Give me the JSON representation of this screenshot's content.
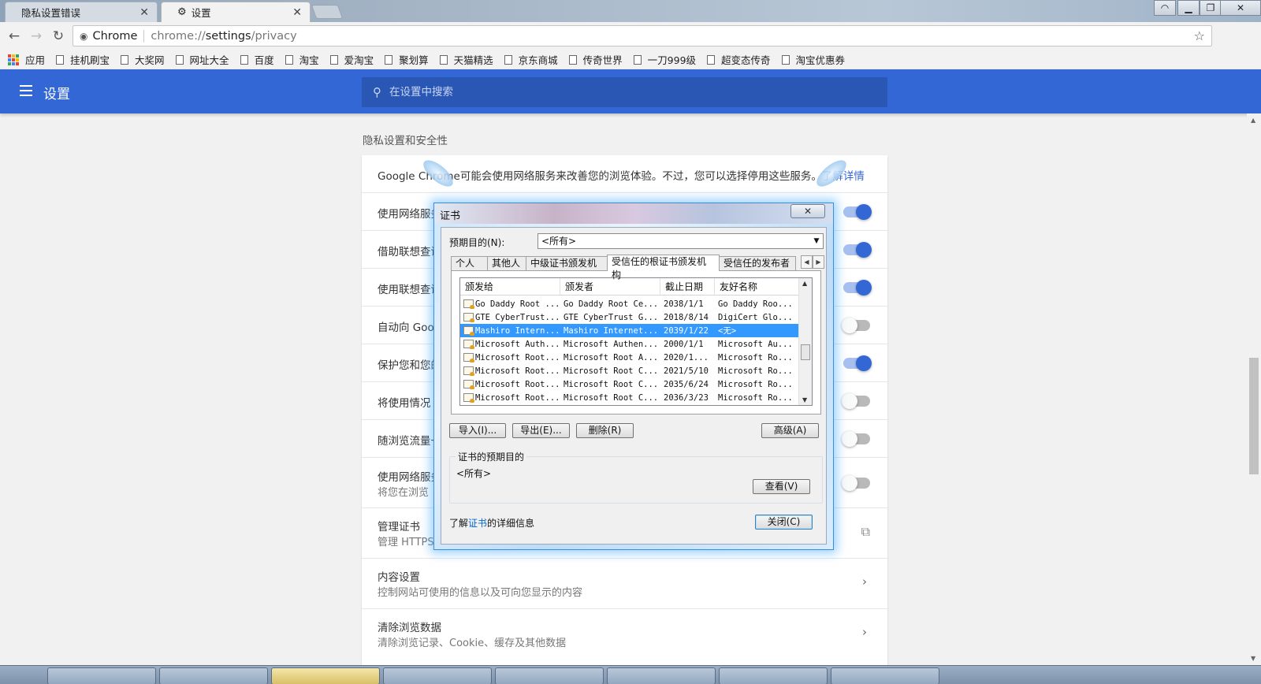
{
  "browser": {
    "tabs": [
      {
        "title": "隐私设置错误",
        "active": false
      },
      {
        "title": "设置",
        "active": true
      }
    ],
    "omnibox": {
      "chip": "Chrome",
      "url_scheme": "chrome://",
      "url_host": "settings",
      "url_path": "/privacy"
    },
    "bookmarks": [
      {
        "label": "应用",
        "icon": "apps-grid-icon"
      },
      {
        "label": "挂机刷宝"
      },
      {
        "label": "大奖网"
      },
      {
        "label": "网址大全"
      },
      {
        "label": "百度"
      },
      {
        "label": "淘宝"
      },
      {
        "label": "爱淘宝"
      },
      {
        "label": "聚划算"
      },
      {
        "label": "天猫精选"
      },
      {
        "label": "京东商城"
      },
      {
        "label": "传奇世界"
      },
      {
        "label": "一刀999级"
      },
      {
        "label": "超变态传奇"
      },
      {
        "label": "淘宝优惠券"
      }
    ]
  },
  "settings": {
    "title": "设置",
    "search_placeholder": "在设置中搜索",
    "section_title": "隐私设置和安全性",
    "intro_text": "Google Chrome可能会使用网络服务来改善您的浏览体验。不过，您可以选择停用这些服务。",
    "intro_link": "了解详情",
    "rows": [
      {
        "label": "使用网络服务",
        "toggle": "on"
      },
      {
        "label": "借助联想查询",
        "toggle": "on"
      },
      {
        "label": "使用联想查询",
        "toggle": "on"
      },
      {
        "label": "自动向 Google",
        "toggle": "off"
      },
      {
        "label": "保护您和您的",
        "toggle": "on"
      },
      {
        "label": "将使用情况",
        "toggle": "off"
      },
      {
        "label": "随浏览流量一",
        "toggle": "off"
      },
      {
        "label": "使用网络服务",
        "sub": "将您在浏览",
        "toggle": "off"
      },
      {
        "label": "管理证书",
        "sub": "管理 HTTPS/SSL 证书和设置",
        "action": "external-link-icon"
      },
      {
        "label": "内容设置",
        "sub": "控制网站可使用的信息以及可向您显示的内容",
        "action": "chevron-right-icon"
      },
      {
        "label": "清除浏览数据",
        "sub": "清除浏览记录、Cookie、缓存及其他数据",
        "action": "chevron-right-icon"
      }
    ]
  },
  "cert_dialog": {
    "title": "证书",
    "close_x": "✕",
    "purpose_label": "预期目的(N):",
    "purpose_value": "<所有>",
    "tabs": [
      "个人",
      "其他人",
      "中级证书颁发机构",
      "受信任的根证书颁发机构",
      "受信任的发布者"
    ],
    "active_tab": 3,
    "columns": [
      "颁发给",
      "颁发者",
      "截止日期",
      "友好名称"
    ],
    "rows": [
      {
        "issued_to": "Go Daddy Root ...",
        "issuer": "Go Daddy Root Ce...",
        "expires": "2038/1/1",
        "friendly": "Go Daddy Roo...",
        "selected": false
      },
      {
        "issued_to": "GTE CyberTrust...",
        "issuer": "GTE CyberTrust G...",
        "expires": "2018/8/14",
        "friendly": "DigiCert Glo...",
        "selected": false
      },
      {
        "issued_to": "Mashiro Intern...",
        "issuer": "Mashiro Internet...",
        "expires": "2039/1/22",
        "friendly": "<无>",
        "selected": true
      },
      {
        "issued_to": "Microsoft Auth...",
        "issuer": "Microsoft Authen...",
        "expires": "2000/1/1",
        "friendly": "Microsoft Au...",
        "selected": false
      },
      {
        "issued_to": "Microsoft Root...",
        "issuer": "Microsoft Root A...",
        "expires": "2020/1...",
        "friendly": "Microsoft Ro...",
        "selected": false
      },
      {
        "issued_to": "Microsoft Root...",
        "issuer": "Microsoft Root C...",
        "expires": "2021/5/10",
        "friendly": "Microsoft Ro...",
        "selected": false
      },
      {
        "issued_to": "Microsoft Root...",
        "issuer": "Microsoft Root C...",
        "expires": "2035/6/24",
        "friendly": "Microsoft Ro...",
        "selected": false
      },
      {
        "issued_to": "Microsoft Root...",
        "issuer": "Microsoft Root C...",
        "expires": "2036/3/23",
        "friendly": "Microsoft Ro...",
        "selected": false
      }
    ],
    "buttons": {
      "import": "导入(I)...",
      "export": "导出(E)...",
      "remove": "删除(R)",
      "advanced": "高级(A)",
      "view": "查看(V)",
      "close": "关闭(C)"
    },
    "purposes_legend": "证书的预期目的",
    "purposes_value": "<所有>",
    "learn_more_prefix": "了解",
    "learn_more_link": "证书",
    "learn_more_suffix": "的详细信息"
  },
  "colors": {
    "settings_blue": "#3367d6",
    "selection_blue": "#3399ff",
    "toggle_on": "#3367d6",
    "toggle_off": "#b9b9b9"
  }
}
